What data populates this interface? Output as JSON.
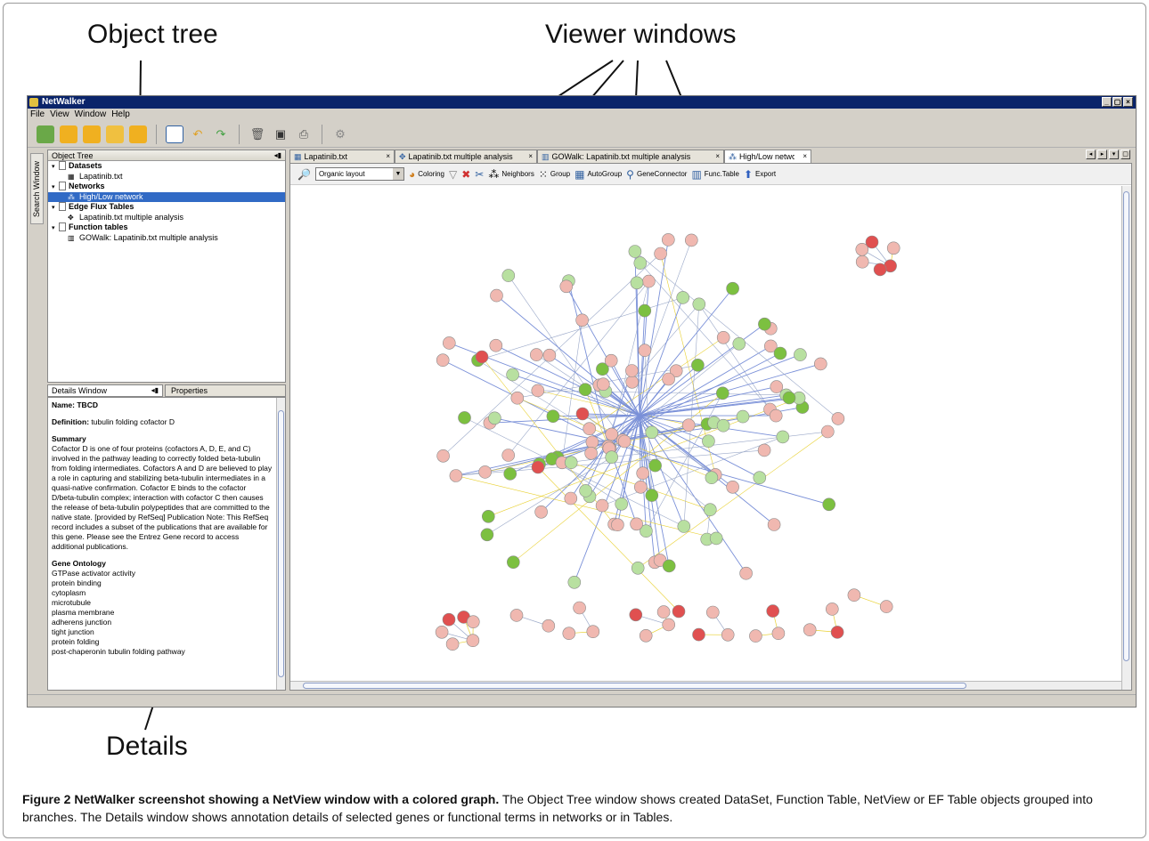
{
  "callouts": {
    "object_tree": "Object tree",
    "viewer_windows": "Viewer windows",
    "details": "Details"
  },
  "app": {
    "title": "NetWalker",
    "window_buttons": [
      "_",
      "▢",
      "×"
    ],
    "menu": [
      "File",
      "View",
      "Window",
      "Help"
    ],
    "side_tab": "Search Window"
  },
  "object_tree": {
    "header": "Object Tree",
    "pin": "◂▮",
    "rows": [
      {
        "label": "Datasets",
        "level": 0,
        "bold": true,
        "icon": "document-icon"
      },
      {
        "label": "Lapatinib.txt",
        "level": 1,
        "bold": false,
        "icon": "table-icon"
      },
      {
        "label": "Networks",
        "level": 0,
        "bold": true,
        "icon": "document-icon"
      },
      {
        "label": "High/Low network",
        "level": 1,
        "bold": false,
        "icon": "network-icon",
        "selected": true
      },
      {
        "label": "Edge Flux Tables",
        "level": 0,
        "bold": true,
        "icon": "document-icon"
      },
      {
        "label": "Lapatinib.txt multiple analysis",
        "level": 1,
        "bold": false,
        "icon": "flux-icon"
      },
      {
        "label": "Function tables",
        "level": 0,
        "bold": true,
        "icon": "document-icon"
      },
      {
        "label": "GOWalk: Lapatinib.txt multiple analysis",
        "level": 1,
        "bold": false,
        "icon": "chart-icon"
      }
    ]
  },
  "details": {
    "tab_details": "Details Window",
    "tab_properties": "Properties",
    "name_label": "Name:",
    "name_value": "TBCD",
    "definition_label": "Definition:",
    "definition_value": "tubulin folding cofactor D",
    "summary_label": "Summary",
    "summary_text": "Cofactor D is one of four proteins (cofactors A, D, E, and C) involved in the pathway leading to correctly folded beta-tubulin from folding intermediates. Cofactors A and D are believed to play a role in capturing and stabilizing beta-tubulin intermediates in a quasi-native confirmation. Cofactor E binds to the cofactor D/beta-tubulin complex; interaction with cofactor C then causes the release of beta-tubulin polypeptides that are committed to the native state. [provided by RefSeq] Publication Note: This RefSeq record includes a subset of the publications that are available for this gene. Please see the Entrez Gene record to access additional publications.",
    "go_label": "Gene Ontology",
    "go_terms": [
      "GTPase activator activity",
      "protein binding",
      "cytoplasm",
      "microtubule",
      "plasma membrane",
      "adherens junction",
      "tight junction",
      "protein folding",
      "post-chaperonin tubulin folding pathway"
    ]
  },
  "viewer_tabs": [
    {
      "label": "Lapatinib.txt",
      "icon": "table-icon",
      "active": false
    },
    {
      "label": "Lapatinib.txt multiple analysis",
      "icon": "flux-icon",
      "active": false
    },
    {
      "label": "GOWalk: Lapatinib.txt multiple analysis",
      "icon": "chart-icon",
      "active": false
    },
    {
      "label": "High/Low network",
      "icon": "network-icon",
      "active": true
    }
  ],
  "viewer_toolbar": {
    "layout_value": "Organic layout",
    "coloring": "Coloring",
    "neighbors": "Neighbors",
    "group": "Group",
    "autogroup": "AutoGroup",
    "geneconnector": "GeneConnector",
    "functable": "Func.Table",
    "export": "Export"
  },
  "graph": {
    "colors": {
      "red": "#e05050",
      "light_red": "#f0b8b0",
      "green": "#7cc040",
      "light_green": "#b8e0a0",
      "edge_blue": "#7a90d8",
      "edge_yellow": "#e8d030",
      "edge_gray": "#9aa8c8"
    }
  },
  "caption": {
    "bold": "Figure 2 NetWalker screenshot showing a NetView window with a colored graph.",
    "text": " The Object Tree window shows created DataSet, Function Table, NetView or EF Table objects grouped into branches. The Details window shows annotation details of selected genes or functional terms in networks or in Tables."
  }
}
